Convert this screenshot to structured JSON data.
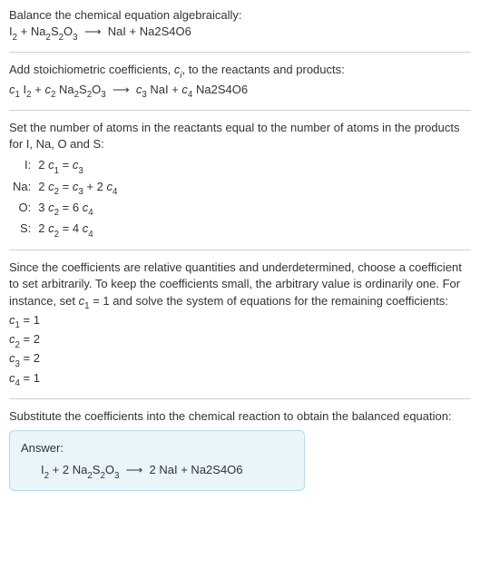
{
  "sec1": {
    "title": "Balance the chemical equation algebraically:",
    "equation_html": "I<span class=\"chem-sub\">2</span> + Na<span class=\"chem-sub\">2</span>S<span class=\"chem-sub\">2</span>O<span class=\"chem-sub\">3</span>&nbsp;&nbsp;⟶&nbsp;&nbsp;NaI + Na2S4O6"
  },
  "sec2": {
    "text_html": "Add stoichiometric coefficients, <span class=\"ci\">c<span class=\"chem-sub\">i</span></span>, to the reactants and products:",
    "equation_html": "<span class=\"ci\">c</span><span class=\"chem-sub\">1</span> I<span class=\"chem-sub\">2</span> + <span class=\"ci\">c</span><span class=\"chem-sub\">2</span> Na<span class=\"chem-sub\">2</span>S<span class=\"chem-sub\">2</span>O<span class=\"chem-sub\">3</span>&nbsp;&nbsp;⟶&nbsp;&nbsp;<span class=\"ci\">c</span><span class=\"chem-sub\">3</span> NaI + <span class=\"ci\">c</span><span class=\"chem-sub\">4</span> Na2S4O6"
  },
  "sec3": {
    "text": "Set the number of atoms in the reactants equal to the number of atoms in the products for I, Na, O and S:",
    "rows": [
      {
        "label": "I:",
        "eq_html": "2 <span class=\"ci\">c</span><span class=\"chem-sub\">1</span> = <span class=\"ci\">c</span><span class=\"chem-sub\">3</span>"
      },
      {
        "label": "Na:",
        "eq_html": "2 <span class=\"ci\">c</span><span class=\"chem-sub\">2</span> = <span class=\"ci\">c</span><span class=\"chem-sub\">3</span> + 2 <span class=\"ci\">c</span><span class=\"chem-sub\">4</span>"
      },
      {
        "label": "O:",
        "eq_html": "3 <span class=\"ci\">c</span><span class=\"chem-sub\">2</span> = 6 <span class=\"ci\">c</span><span class=\"chem-sub\">4</span>"
      },
      {
        "label": "S:",
        "eq_html": "2 <span class=\"ci\">c</span><span class=\"chem-sub\">2</span> = 4 <span class=\"ci\">c</span><span class=\"chem-sub\">4</span>"
      }
    ]
  },
  "sec4": {
    "text_html": "Since the coefficients are relative quantities and underdetermined, choose a coefficient to set arbitrarily. To keep the coefficients small, the arbitrary value is ordinarily one. For instance, set <span class=\"ci\">c</span><span class=\"chem-sub\">1</span> = 1 and solve the system of equations for the remaining coefficients:",
    "lines_html": [
      "<span class=\"ci\">c</span><span class=\"chem-sub\">1</span> = 1",
      "<span class=\"ci\">c</span><span class=\"chem-sub\">2</span> = 2",
      "<span class=\"ci\">c</span><span class=\"chem-sub\">3</span> = 2",
      "<span class=\"ci\">c</span><span class=\"chem-sub\">4</span> = 1"
    ]
  },
  "sec5": {
    "text": "Substitute the coefficients into the chemical reaction to obtain the balanced equation:",
    "answer_label": "Answer:",
    "answer_html": "I<span class=\"chem-sub\">2</span> + 2 Na<span class=\"chem-sub\">2</span>S<span class=\"chem-sub\">2</span>O<span class=\"chem-sub\">3</span>&nbsp;&nbsp;⟶&nbsp;&nbsp;2 NaI + Na2S4O6"
  }
}
